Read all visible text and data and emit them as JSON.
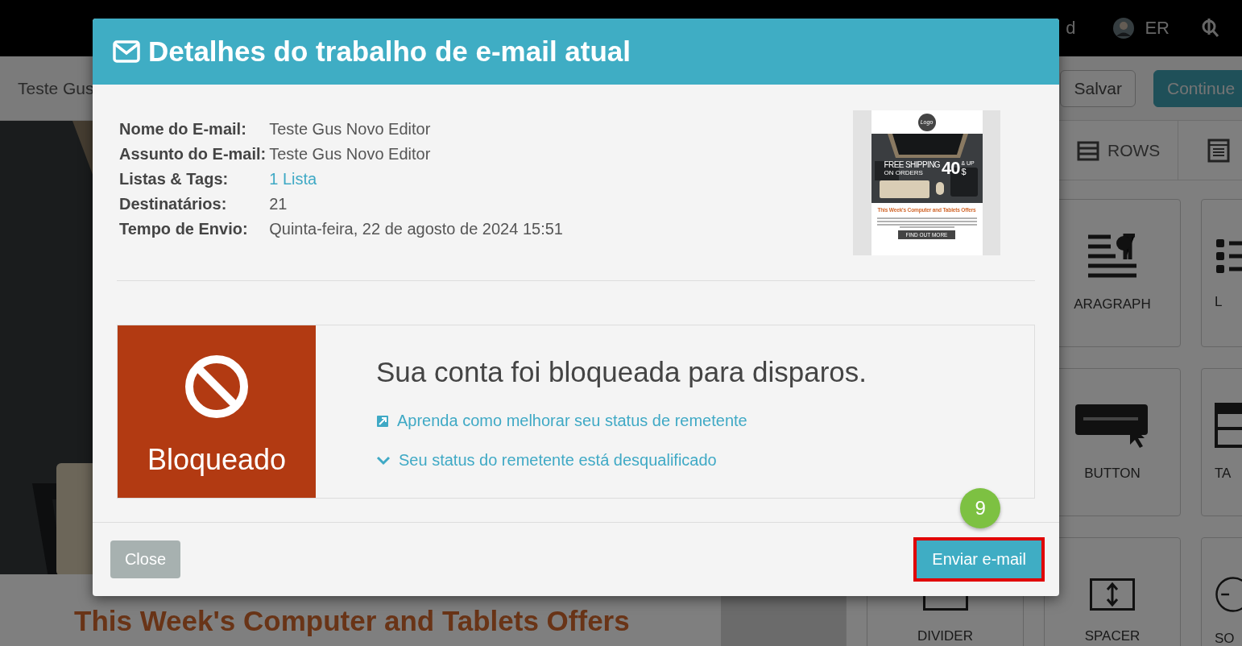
{
  "top_bar": {
    "partial_text": "d",
    "user_initials": "ER"
  },
  "toolbar": {
    "email_name": "Teste Gus",
    "buttons": [
      {
        "label": "Salvar",
        "kind": "secondary"
      },
      {
        "label": "Continue",
        "kind": "primary"
      }
    ]
  },
  "canvas": {
    "headline": "This Week's Computer and Tablets Offers"
  },
  "panel": {
    "tabs": [
      {
        "label": "ROWS"
      }
    ],
    "block_rows": [
      [
        {
          "kind": "paragraph",
          "label": "ARAGRAPH"
        },
        {
          "kind": "list",
          "label": "L"
        }
      ],
      [
        {
          "kind": "button",
          "label": "BUTTON"
        },
        {
          "kind": "table",
          "label": "TA"
        }
      ],
      [
        {
          "kind": "divider",
          "label": "DIVIDER"
        },
        {
          "kind": "spacer",
          "label": "SPACER"
        },
        {
          "kind": "social",
          "label": "SO"
        }
      ]
    ]
  },
  "dialog": {
    "title": "Detalhes do trabalho de e-mail atual",
    "details": [
      {
        "label": "Nome do E-mail:",
        "value": "Teste Gus Novo Editor",
        "kind": "text"
      },
      {
        "label": "Assunto do E-mail:",
        "value": "Teste Gus Novo Editor",
        "kind": "text"
      },
      {
        "label": "Listas & Tags:",
        "value": "1 Lista",
        "kind": "link"
      },
      {
        "label": "Destinatários:",
        "value": "21",
        "kind": "text"
      },
      {
        "label": "Tempo de Envio:",
        "value": "Quinta-feira, 22 de agosto de 2024 15:51",
        "kind": "text"
      }
    ],
    "preview": {
      "logo": "Logo",
      "banner": "FREE SHIPPING",
      "banner_sub": "ON ORDERS",
      "amount": "40",
      "currency": "$",
      "amount_note": "& UP",
      "headline": "This Week's Computer and Tablets Offers",
      "button": "FIND OUT MORE"
    },
    "status": {
      "state_label": "Bloqueado",
      "heading": "Sua conta foi bloqueada para disparos.",
      "links": [
        {
          "kind": "external",
          "text": "Aprenda como melhorar seu status de remetente"
        },
        {
          "kind": "expand",
          "text": "Seu status do remetente está desqualificado"
        }
      ]
    },
    "footer": {
      "close": "Close",
      "send": "Enviar e-mail",
      "step_badge": "9",
      "send_highlighted": true
    }
  }
}
